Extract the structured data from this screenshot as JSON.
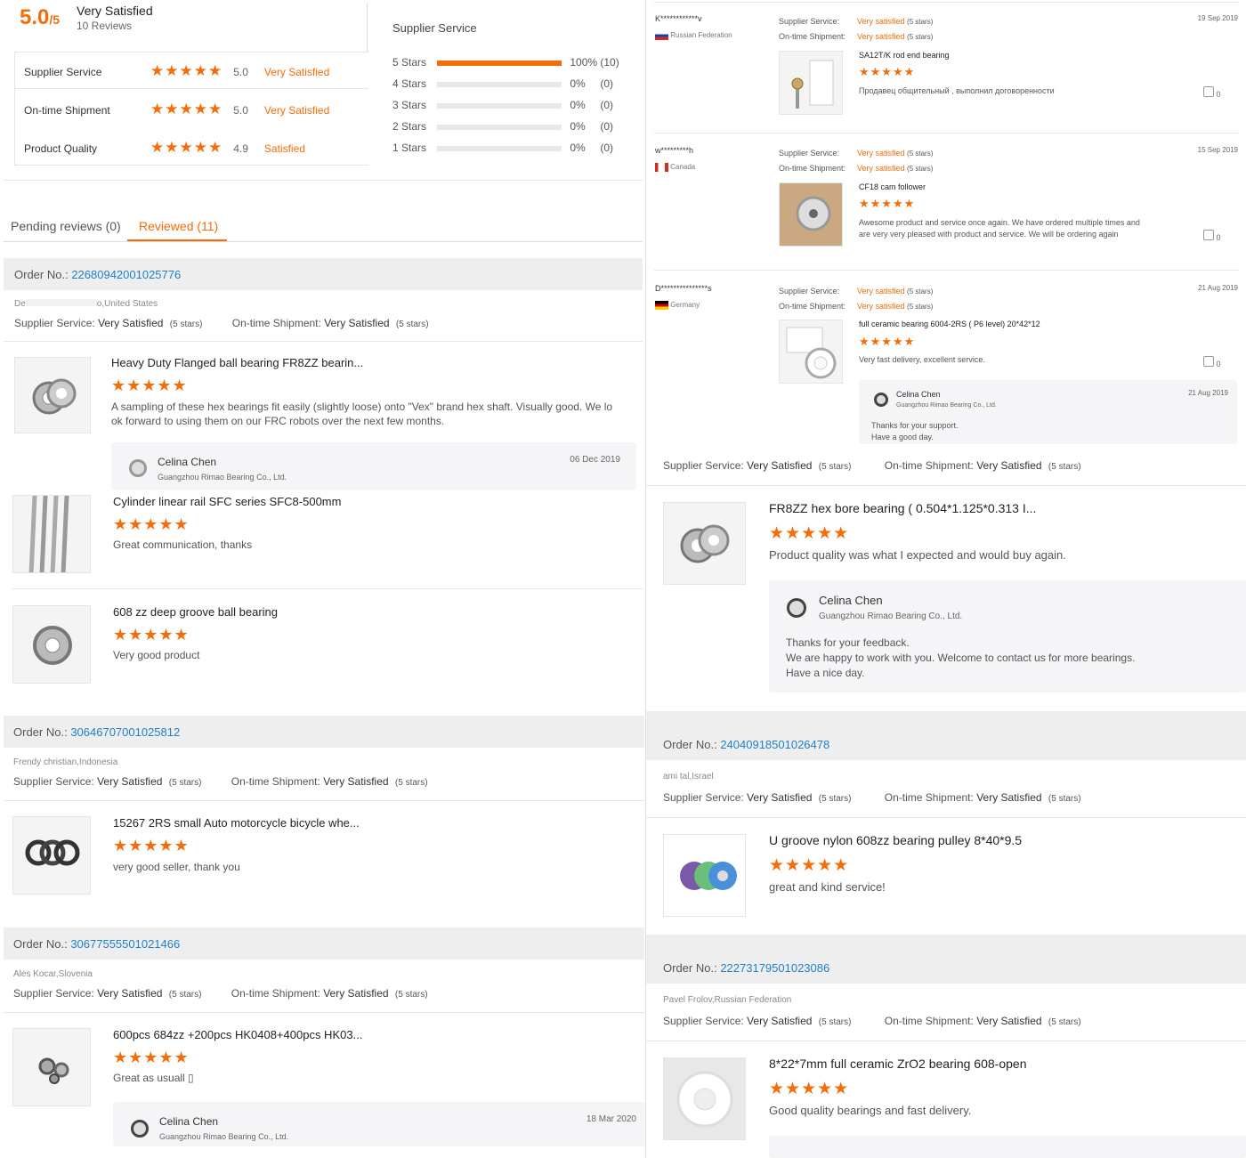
{
  "summary": {
    "score": "5.0",
    "scale": "/5",
    "label": "Very Satisfied",
    "reviews": "10 Reviews"
  },
  "ratings": [
    {
      "name": "Supplier Service",
      "value": "5.0",
      "label": "Very Satisfied"
    },
    {
      "name": "On-time Shipment",
      "value": "5.0",
      "label": "Very Satisfied"
    },
    {
      "name": "Product Quality",
      "value": "4.9",
      "label": "Satisfied"
    }
  ],
  "supplier_service": {
    "title": "Supplier Service",
    "rows": [
      {
        "stars": "5",
        "label": "Stars",
        "pct": "100%",
        "count": "(10)",
        "fill": 1.0
      },
      {
        "stars": "4",
        "label": "Stars",
        "pct": "0%",
        "count": "(0)",
        "fill": 0
      },
      {
        "stars": "3",
        "label": "Stars",
        "pct": "0%",
        "count": "(0)",
        "fill": 0
      },
      {
        "stars": "2",
        "label": "Stars",
        "pct": "0%",
        "count": "(0)",
        "fill": 0
      },
      {
        "stars": "1",
        "label": "Stars",
        "pct": "0%",
        "count": "(0)",
        "fill": 0
      }
    ]
  },
  "tabs": {
    "pending": "Pending reviews (0)",
    "reviewed": "Reviewed (11)"
  },
  "labels": {
    "order_no": "Order No.:",
    "supplier_service": "Supplier Service:",
    "ontime": "On-time Shipment:",
    "very_satisfied": "Very Satisfied",
    "five_stars": "(5 stars)",
    "very_satisfied_lc": "Very satisfied",
    "stars": "★★★★★",
    "like_count": "0"
  },
  "seller": {
    "name": "Celina Chen",
    "company": "Guangzhou Rimao Bearing Co., Ltd."
  },
  "left": {
    "order1": {
      "number": "22680942001025776",
      "buyer": "De",
      "buyer_suffix": "o,United States",
      "items": [
        {
          "title": "Heavy Duty Flanged ball bearing FR8ZZ bearin...",
          "text1": "A sampling of these hex bearings fit easily (slightly loose) onto \"Vex\" brand hex shaft.  Visually good.  We lo",
          "text2": "ok forward to using them on our FRC robots over the next few months.",
          "reply_date": "06 Dec 2019"
        },
        {
          "title": "Cylinder linear rail SFC series SFC8-500mm",
          "text": "Great communication, thanks"
        },
        {
          "title": "608 zz deep groove ball bearing",
          "text": "Very good product"
        }
      ]
    },
    "order2": {
      "number": "30646707001025812",
      "buyer": "Frendy christian,Indonesia",
      "items": [
        {
          "title": "15267 2RS small Auto motorcycle bicycle whe...",
          "text": "very good seller, thank you"
        }
      ]
    },
    "order3": {
      "number": "30677555501021466",
      "buyer": "Ales Kocar,Slovenia",
      "items": [
        {
          "title": "600pcs 684zz +200pcs HK0408+400pcs HK03...",
          "text": "Great as usuall ▯",
          "reply_date": "18 Mar 2020"
        }
      ]
    }
  },
  "right": {
    "reviews": [
      {
        "user": "K************v",
        "country": "Russian Federation",
        "date": "19 Sep 2019",
        "product": "SA12T/K rod end bearing",
        "text1": "Продавец общительный , выполнил договоренности",
        "text2": ""
      },
      {
        "user": "w*********h",
        "country": "Canada",
        "date": "15 Sep 2019",
        "product": "CF18 cam follower",
        "text1": "Awesome product and service once again. We have ordered multiple times and",
        "text2": "are very very pleased with product and service. We will be ordering again"
      },
      {
        "user": "D***************s",
        "country": "Germany",
        "date": "21 Aug 2019",
        "product": "full ceramic bearing 6004-2RS ( P6 level) 20*42*12",
        "text1": "Very fast delivery, excellent service.",
        "text2": "",
        "reply_date": "21 Aug 2019",
        "reply1": "Thanks for your support.",
        "reply2": "Have a good day."
      }
    ],
    "big1": {
      "title": "FR8ZZ hex bore bearing ( 0.504*1.125*0.313 I...",
      "text": "Product quality was what I expected and would buy again.",
      "reply1": "Thanks for your feedback.",
      "reply2": "We are happy to work with you. Welcome to contact us for more bearings.",
      "reply3": "Have a nice day."
    },
    "order4": {
      "number": "24040918501026478",
      "buyer": "ami tal,Israel",
      "title": "U groove nylon 608zz bearing pulley 8*40*9.5",
      "text": "great and kind service!"
    },
    "order5": {
      "number": "22273179501023086",
      "buyer": "Pavel Frolov,Russian Federation",
      "title": "8*22*7mm full ceramic ZrO2 bearing 608-open",
      "text": "Good quality bearings and fast delivery."
    }
  }
}
